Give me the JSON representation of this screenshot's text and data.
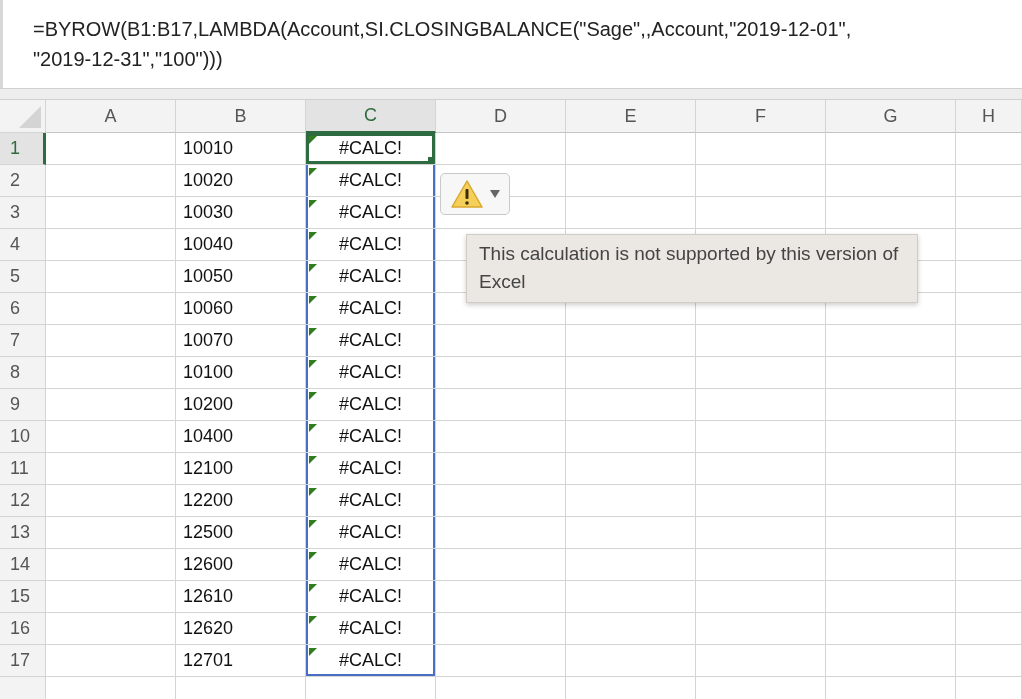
{
  "formula_bar": {
    "text": "=BYROW(B1:B17,LAMBDA(Account,SI.CLOSINGBALANCE(\"Sage\",,Account,\"2019-12-01\",\n\"2019-12-31\",\"100\")))"
  },
  "columns": [
    {
      "label": "A",
      "selected": false
    },
    {
      "label": "B",
      "selected": false
    },
    {
      "label": "C",
      "selected": true
    },
    {
      "label": "D",
      "selected": false
    },
    {
      "label": "E",
      "selected": false
    },
    {
      "label": "F",
      "selected": false
    },
    {
      "label": "G",
      "selected": false
    },
    {
      "label": "H",
      "selected": false
    }
  ],
  "rows": [
    {
      "label": "1",
      "selected": true,
      "account": "10010",
      "result": {
        "text": "#CALC!",
        "error_indicator": true,
        "selected": true,
        "active": true
      }
    },
    {
      "label": "2",
      "selected": false,
      "account": "10020",
      "result": {
        "text": "#CALC!",
        "error_indicator": true,
        "selected": true,
        "active": false
      }
    },
    {
      "label": "3",
      "selected": false,
      "account": "10030",
      "result": {
        "text": "#CALC!",
        "error_indicator": true,
        "selected": true,
        "active": false
      }
    },
    {
      "label": "4",
      "selected": false,
      "account": "10040",
      "result": {
        "text": "#CALC!",
        "error_indicator": true,
        "selected": true,
        "active": false
      }
    },
    {
      "label": "5",
      "selected": false,
      "account": "10050",
      "result": {
        "text": "#CALC!",
        "error_indicator": true,
        "selected": true,
        "active": false
      }
    },
    {
      "label": "6",
      "selected": false,
      "account": "10060",
      "result": {
        "text": "#CALC!",
        "error_indicator": true,
        "selected": true,
        "active": false
      }
    },
    {
      "label": "7",
      "selected": false,
      "account": "10070",
      "result": {
        "text": "#CALC!",
        "error_indicator": true,
        "selected": true,
        "active": false
      }
    },
    {
      "label": "8",
      "selected": false,
      "account": "10100",
      "result": {
        "text": "#CALC!",
        "error_indicator": true,
        "selected": true,
        "active": false
      }
    },
    {
      "label": "9",
      "selected": false,
      "account": "10200",
      "result": {
        "text": "#CALC!",
        "error_indicator": true,
        "selected": true,
        "active": false
      }
    },
    {
      "label": "10",
      "selected": false,
      "account": "10400",
      "result": {
        "text": "#CALC!",
        "error_indicator": true,
        "selected": true,
        "active": false
      }
    },
    {
      "label": "11",
      "selected": false,
      "account": "12100",
      "result": {
        "text": "#CALC!",
        "error_indicator": true,
        "selected": true,
        "active": false
      }
    },
    {
      "label": "12",
      "selected": false,
      "account": "12200",
      "result": {
        "text": "#CALC!",
        "error_indicator": true,
        "selected": true,
        "active": false
      }
    },
    {
      "label": "13",
      "selected": false,
      "account": "12500",
      "result": {
        "text": "#CALC!",
        "error_indicator": true,
        "selected": true,
        "active": false
      }
    },
    {
      "label": "14",
      "selected": false,
      "account": "12600",
      "result": {
        "text": "#CALC!",
        "error_indicator": true,
        "selected": true,
        "active": false
      }
    },
    {
      "label": "15",
      "selected": false,
      "account": "12610",
      "result": {
        "text": "#CALC!",
        "error_indicator": true,
        "selected": true,
        "active": false
      }
    },
    {
      "label": "16",
      "selected": false,
      "account": "12620",
      "result": {
        "text": "#CALC!",
        "error_indicator": true,
        "selected": true,
        "active": false
      }
    },
    {
      "label": "17",
      "selected": false,
      "account": "12701",
      "result": {
        "text": "#CALC!",
        "error_indicator": true,
        "selected": true,
        "active": false
      }
    }
  ],
  "error_popup": {
    "tooltip": "This calculation is not supported by this version of Excel"
  }
}
